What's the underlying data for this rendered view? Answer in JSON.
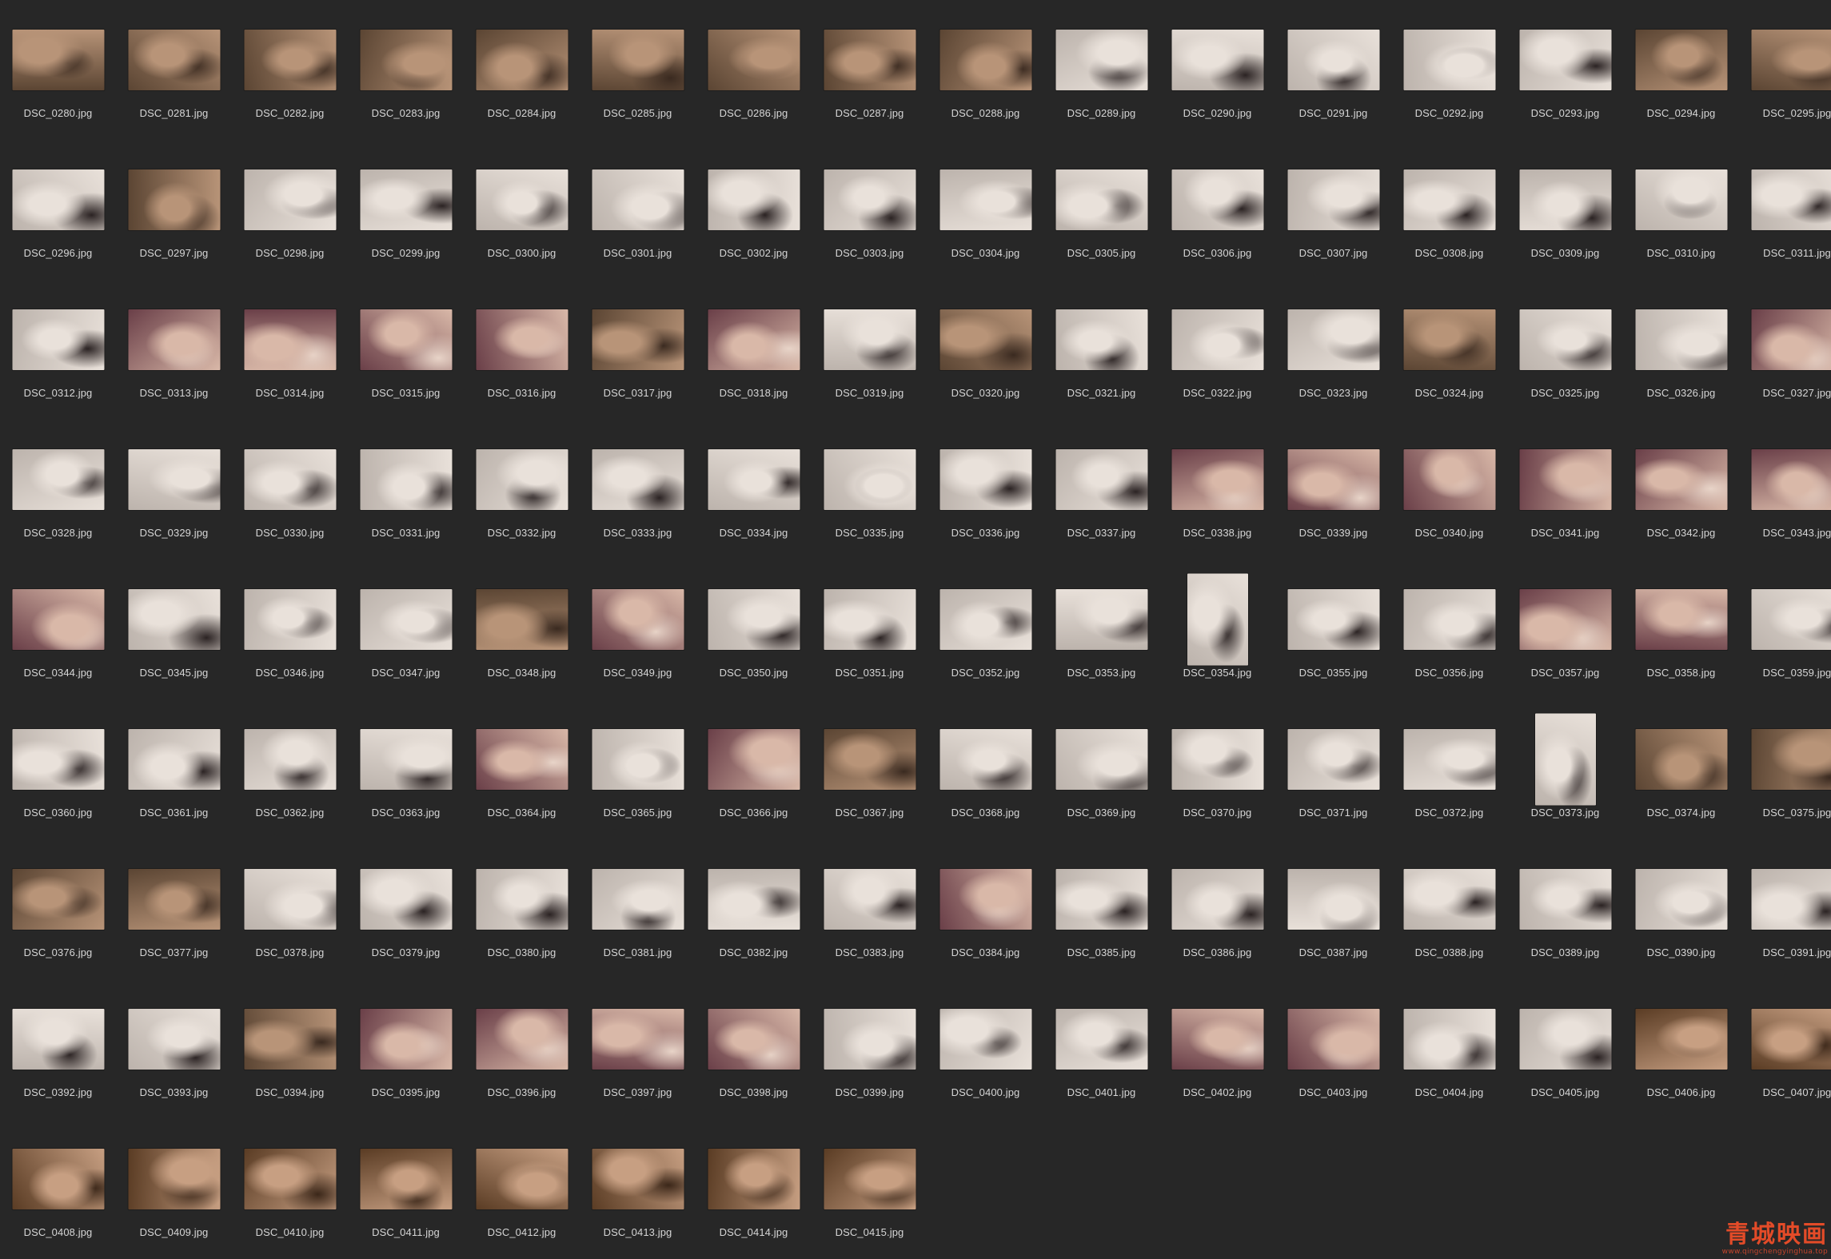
{
  "files": [
    {
      "name": "DSC_0280.jpg",
      "tone": "warm"
    },
    {
      "name": "DSC_0281.jpg",
      "tone": "warm"
    },
    {
      "name": "DSC_0282.jpg",
      "tone": "warm"
    },
    {
      "name": "DSC_0283.jpg",
      "tone": "warm"
    },
    {
      "name": "DSC_0284.jpg",
      "tone": "warm"
    },
    {
      "name": "DSC_0285.jpg",
      "tone": "warm"
    },
    {
      "name": "DSC_0286.jpg",
      "tone": "warm"
    },
    {
      "name": "DSC_0287.jpg",
      "tone": "warm"
    },
    {
      "name": "DSC_0288.jpg",
      "tone": "warm"
    },
    {
      "name": "DSC_0289.jpg",
      "tone": "light"
    },
    {
      "name": "DSC_0290.jpg",
      "tone": "light"
    },
    {
      "name": "DSC_0291.jpg",
      "tone": "light"
    },
    {
      "name": "DSC_0292.jpg",
      "tone": "light"
    },
    {
      "name": "DSC_0293.jpg",
      "tone": "light"
    },
    {
      "name": "DSC_0294.jpg",
      "tone": "warm"
    },
    {
      "name": "DSC_0295.jpg",
      "tone": "warm"
    },
    {
      "name": "DSC_0296.jpg",
      "tone": "light"
    },
    {
      "name": "DSC_0297.jpg",
      "tone": "warm"
    },
    {
      "name": "DSC_0298.jpg",
      "tone": "light"
    },
    {
      "name": "DSC_0299.jpg",
      "tone": "light"
    },
    {
      "name": "DSC_0300.jpg",
      "tone": "light"
    },
    {
      "name": "DSC_0301.jpg",
      "tone": "light"
    },
    {
      "name": "DSC_0302.jpg",
      "tone": "light"
    },
    {
      "name": "DSC_0303.jpg",
      "tone": "light"
    },
    {
      "name": "DSC_0304.jpg",
      "tone": "light"
    },
    {
      "name": "DSC_0305.jpg",
      "tone": "light"
    },
    {
      "name": "DSC_0306.jpg",
      "tone": "light"
    },
    {
      "name": "DSC_0307.jpg",
      "tone": "light"
    },
    {
      "name": "DSC_0308.jpg",
      "tone": "light"
    },
    {
      "name": "DSC_0309.jpg",
      "tone": "light"
    },
    {
      "name": "DSC_0310.jpg",
      "tone": "light"
    },
    {
      "name": "DSC_0311.jpg",
      "tone": "light"
    },
    {
      "name": "DSC_0312.jpg",
      "tone": "light"
    },
    {
      "name": "DSC_0313.jpg",
      "tone": "pink"
    },
    {
      "name": "DSC_0314.jpg",
      "tone": "pink"
    },
    {
      "name": "DSC_0315.jpg",
      "tone": "pink"
    },
    {
      "name": "DSC_0316.jpg",
      "tone": "pink"
    },
    {
      "name": "DSC_0317.jpg",
      "tone": "warm"
    },
    {
      "name": "DSC_0318.jpg",
      "tone": "pink"
    },
    {
      "name": "DSC_0319.jpg",
      "tone": "light"
    },
    {
      "name": "DSC_0320.jpg",
      "tone": "warm"
    },
    {
      "name": "DSC_0321.jpg",
      "tone": "light"
    },
    {
      "name": "DSC_0322.jpg",
      "tone": "light"
    },
    {
      "name": "DSC_0323.jpg",
      "tone": "light"
    },
    {
      "name": "DSC_0324.jpg",
      "tone": "warm"
    },
    {
      "name": "DSC_0325.jpg",
      "tone": "light"
    },
    {
      "name": "DSC_0326.jpg",
      "tone": "light"
    },
    {
      "name": "DSC_0327.jpg",
      "tone": "pink"
    },
    {
      "name": "DSC_0328.jpg",
      "tone": "light"
    },
    {
      "name": "DSC_0329.jpg",
      "tone": "light"
    },
    {
      "name": "DSC_0330.jpg",
      "tone": "light"
    },
    {
      "name": "DSC_0331.jpg",
      "tone": "light"
    },
    {
      "name": "DSC_0332.jpg",
      "tone": "light"
    },
    {
      "name": "DSC_0333.jpg",
      "tone": "light"
    },
    {
      "name": "DSC_0334.jpg",
      "tone": "light"
    },
    {
      "name": "DSC_0335.jpg",
      "tone": "light"
    },
    {
      "name": "DSC_0336.jpg",
      "tone": "light"
    },
    {
      "name": "DSC_0337.jpg",
      "tone": "light"
    },
    {
      "name": "DSC_0338.jpg",
      "tone": "pink"
    },
    {
      "name": "DSC_0339.jpg",
      "tone": "pink"
    },
    {
      "name": "DSC_0340.jpg",
      "tone": "pink"
    },
    {
      "name": "DSC_0341.jpg",
      "tone": "pink"
    },
    {
      "name": "DSC_0342.jpg",
      "tone": "pink"
    },
    {
      "name": "DSC_0343.jpg",
      "tone": "pink"
    },
    {
      "name": "DSC_0344.jpg",
      "tone": "pink"
    },
    {
      "name": "DSC_0345.jpg",
      "tone": "light"
    },
    {
      "name": "DSC_0346.jpg",
      "tone": "light"
    },
    {
      "name": "DSC_0347.jpg",
      "tone": "light"
    },
    {
      "name": "DSC_0348.jpg",
      "tone": "warm"
    },
    {
      "name": "DSC_0349.jpg",
      "tone": "pink"
    },
    {
      "name": "DSC_0350.jpg",
      "tone": "light"
    },
    {
      "name": "DSC_0351.jpg",
      "tone": "light"
    },
    {
      "name": "DSC_0352.jpg",
      "tone": "light"
    },
    {
      "name": "DSC_0353.jpg",
      "tone": "light"
    },
    {
      "name": "DSC_0354.jpg",
      "tone": "light",
      "portrait": true
    },
    {
      "name": "DSC_0355.jpg",
      "tone": "light"
    },
    {
      "name": "DSC_0356.jpg",
      "tone": "light"
    },
    {
      "name": "DSC_0357.jpg",
      "tone": "pink"
    },
    {
      "name": "DSC_0358.jpg",
      "tone": "pink"
    },
    {
      "name": "DSC_0359.jpg",
      "tone": "light"
    },
    {
      "name": "DSC_0360.jpg",
      "tone": "light"
    },
    {
      "name": "DSC_0361.jpg",
      "tone": "light"
    },
    {
      "name": "DSC_0362.jpg",
      "tone": "light"
    },
    {
      "name": "DSC_0363.jpg",
      "tone": "light"
    },
    {
      "name": "DSC_0364.jpg",
      "tone": "pink"
    },
    {
      "name": "DSC_0365.jpg",
      "tone": "light"
    },
    {
      "name": "DSC_0366.jpg",
      "tone": "pink"
    },
    {
      "name": "DSC_0367.jpg",
      "tone": "warm"
    },
    {
      "name": "DSC_0368.jpg",
      "tone": "light"
    },
    {
      "name": "DSC_0369.jpg",
      "tone": "light"
    },
    {
      "name": "DSC_0370.jpg",
      "tone": "light"
    },
    {
      "name": "DSC_0371.jpg",
      "tone": "light"
    },
    {
      "name": "DSC_0372.jpg",
      "tone": "light"
    },
    {
      "name": "DSC_0373.jpg",
      "tone": "light",
      "portrait": true
    },
    {
      "name": "DSC_0374.jpg",
      "tone": "warm"
    },
    {
      "name": "DSC_0375.jpg",
      "tone": "warm"
    },
    {
      "name": "DSC_0376.jpg",
      "tone": "warm"
    },
    {
      "name": "DSC_0377.jpg",
      "tone": "warm"
    },
    {
      "name": "DSC_0378.jpg",
      "tone": "light"
    },
    {
      "name": "DSC_0379.jpg",
      "tone": "light"
    },
    {
      "name": "DSC_0380.jpg",
      "tone": "light"
    },
    {
      "name": "DSC_0381.jpg",
      "tone": "light"
    },
    {
      "name": "DSC_0382.jpg",
      "tone": "light"
    },
    {
      "name": "DSC_0383.jpg",
      "tone": "light"
    },
    {
      "name": "DSC_0384.jpg",
      "tone": "pink"
    },
    {
      "name": "DSC_0385.jpg",
      "tone": "light"
    },
    {
      "name": "DSC_0386.jpg",
      "tone": "light"
    },
    {
      "name": "DSC_0387.jpg",
      "tone": "light"
    },
    {
      "name": "DSC_0388.jpg",
      "tone": "light"
    },
    {
      "name": "DSC_0389.jpg",
      "tone": "light"
    },
    {
      "name": "DSC_0390.jpg",
      "tone": "light"
    },
    {
      "name": "DSC_0391.jpg",
      "tone": "light"
    },
    {
      "name": "DSC_0392.jpg",
      "tone": "light"
    },
    {
      "name": "DSC_0393.jpg",
      "tone": "light"
    },
    {
      "name": "DSC_0394.jpg",
      "tone": "warm"
    },
    {
      "name": "DSC_0395.jpg",
      "tone": "pink"
    },
    {
      "name": "DSC_0396.jpg",
      "tone": "pink"
    },
    {
      "name": "DSC_0397.jpg",
      "tone": "pink"
    },
    {
      "name": "DSC_0398.jpg",
      "tone": "pink"
    },
    {
      "name": "DSC_0399.jpg",
      "tone": "light"
    },
    {
      "name": "DSC_0400.jpg",
      "tone": "light"
    },
    {
      "name": "DSC_0401.jpg",
      "tone": "light"
    },
    {
      "name": "DSC_0402.jpg",
      "tone": "pink"
    },
    {
      "name": "DSC_0403.jpg",
      "tone": "pink"
    },
    {
      "name": "DSC_0404.jpg",
      "tone": "light"
    },
    {
      "name": "DSC_0405.jpg",
      "tone": "light"
    },
    {
      "name": "DSC_0406.jpg",
      "tone": "wood"
    },
    {
      "name": "DSC_0407.jpg",
      "tone": "wood"
    },
    {
      "name": "DSC_0408.jpg",
      "tone": "wood"
    },
    {
      "name": "DSC_0409.jpg",
      "tone": "wood"
    },
    {
      "name": "DSC_0410.jpg",
      "tone": "wood"
    },
    {
      "name": "DSC_0411.jpg",
      "tone": "wood"
    },
    {
      "name": "DSC_0412.jpg",
      "tone": "wood"
    },
    {
      "name": "DSC_0413.jpg",
      "tone": "wood"
    },
    {
      "name": "DSC_0414.jpg",
      "tone": "wood"
    },
    {
      "name": "DSC_0415.jpg",
      "tone": "wood"
    }
  ],
  "tones": {
    "warm": [
      "#5b4533",
      "#b89478",
      "#3a2a20"
    ],
    "light": [
      "#bcb3ac",
      "#e9e1da",
      "#2b2323"
    ],
    "pink": [
      "#6a3f48",
      "#d9b8a8",
      "#e8d4c8"
    ],
    "wood": [
      "#5a3c24",
      "#c79f82",
      "#3b2719"
    ]
  },
  "background_color": "#272727",
  "watermark": {
    "text": "青城映画",
    "url": "www.qingchengyinghua.top",
    "color": "#e34b28"
  }
}
